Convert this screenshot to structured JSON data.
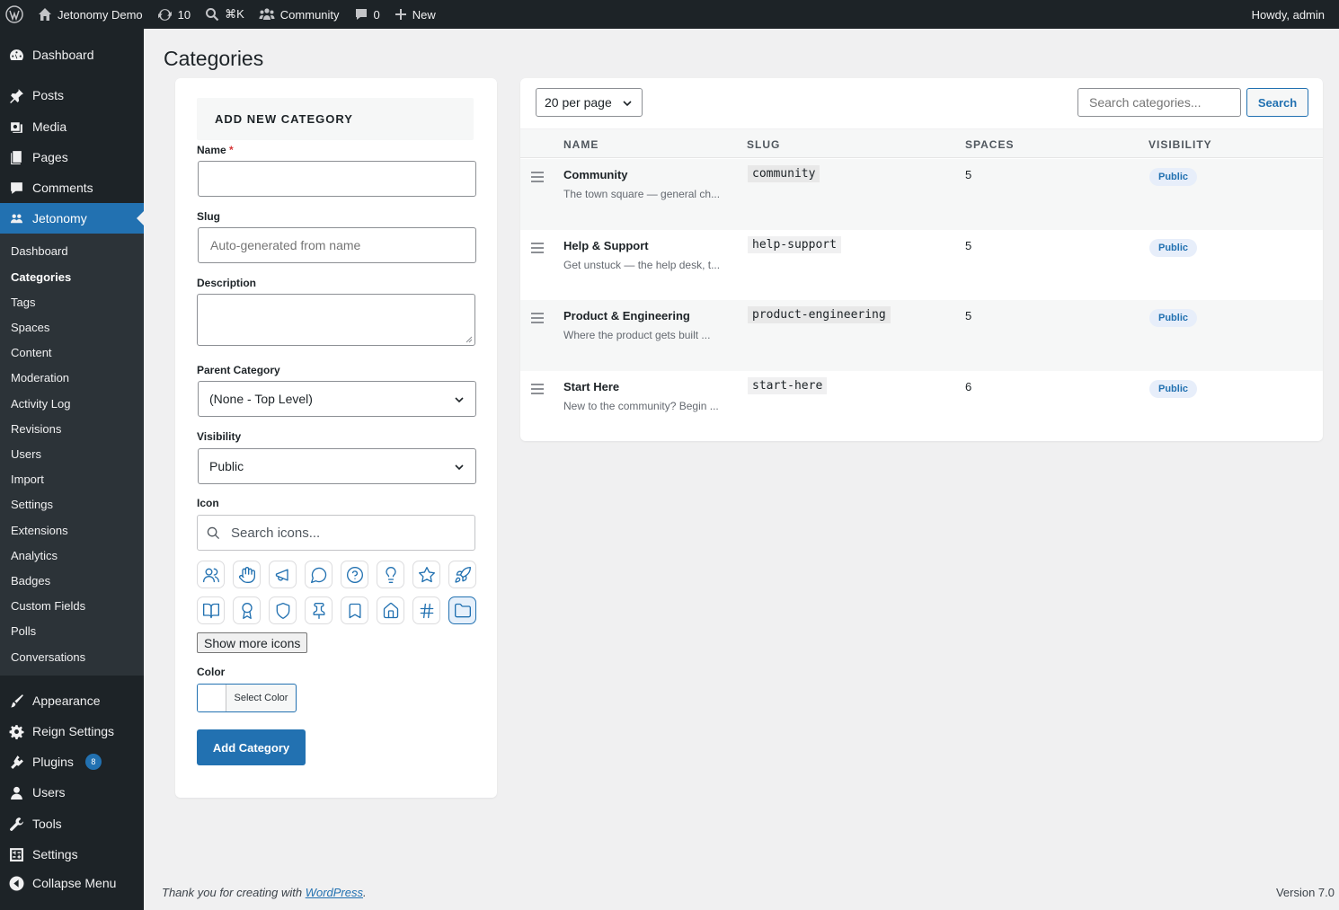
{
  "adminbar": {
    "site_name": "Jetonomy Demo",
    "updates_count": "10",
    "search_shortcut": "⌘K",
    "community_label": "Community",
    "comments_count": "0",
    "new_label": "New",
    "greeting": "Howdy, admin"
  },
  "sidebar": {
    "top_items": [
      {
        "label": "Dashboard",
        "icon": "dashboard-icon"
      },
      {
        "label": "Posts",
        "icon": "pin-icon"
      },
      {
        "label": "Media",
        "icon": "media-icon"
      },
      {
        "label": "Pages",
        "icon": "pages-icon"
      },
      {
        "label": "Comments",
        "icon": "comments-icon"
      },
      {
        "label": "Jetonomy",
        "icon": "groups-icon"
      }
    ],
    "submenu": [
      "Dashboard",
      "Categories",
      "Tags",
      "Spaces",
      "Content",
      "Moderation",
      "Activity Log",
      "Revisions",
      "Users",
      "Import",
      "Settings",
      "Extensions",
      "Analytics",
      "Badges",
      "Custom Fields",
      "Polls",
      "Conversations"
    ],
    "bottom_items": [
      {
        "label": "Appearance",
        "icon": "appearance-icon"
      },
      {
        "label": "Reign Settings",
        "icon": "gear-icon"
      },
      {
        "label": "Plugins",
        "icon": "plugins-icon",
        "badge": "8"
      },
      {
        "label": "Users",
        "icon": "users-icon"
      },
      {
        "label": "Tools",
        "icon": "tools-icon"
      },
      {
        "label": "Settings",
        "icon": "settings-icon"
      },
      {
        "label": "Collapse Menu",
        "icon": "collapse-icon"
      }
    ],
    "accent": "#2271b1"
  },
  "page": {
    "title": "Categories"
  },
  "form": {
    "header": "ADD NEW CATEGORY",
    "name_label": "Name",
    "required_mark": "*",
    "name_value": "",
    "slug_label": "Slug",
    "slug_placeholder": "Auto-generated from name",
    "description_label": "Description",
    "parent_label": "Parent Category",
    "parent_value": "(None - Top Level)",
    "visibility_label": "Visibility",
    "visibility_value": "Public",
    "icon_label": "Icon",
    "icon_search_placeholder": "Search icons...",
    "icons": [
      "users-icon",
      "hand-icon",
      "megaphone-icon",
      "chat-bubble-icon",
      "help-circle-icon",
      "lightbulb-icon",
      "star-icon",
      "rocket-icon",
      "book-icon",
      "award-icon",
      "shield-icon",
      "pin-icon",
      "bookmark-icon",
      "home-icon",
      "hash-icon",
      "folder-icon"
    ],
    "selected_icon": "folder-icon",
    "show_more_label": "Show more icons",
    "color_label": "Color",
    "color_button": "Select Color",
    "submit_label": "Add Category"
  },
  "list": {
    "per_page": "20 per page",
    "search_placeholder": "Search categories...",
    "search_button": "Search",
    "columns": [
      "NAME",
      "SLUG",
      "SPACES",
      "VISIBILITY"
    ],
    "rows": [
      {
        "name": "Community",
        "desc": "The town square — general ch...",
        "slug": "community",
        "spaces": "5",
        "visibility": "Public"
      },
      {
        "name": "Help & Support",
        "desc": "Get unstuck — the help desk, t...",
        "slug": "help-support",
        "spaces": "5",
        "visibility": "Public"
      },
      {
        "name": "Product & Engineering",
        "desc": "Where the product gets built ...",
        "slug": "product-engineering",
        "spaces": "5",
        "visibility": "Public"
      },
      {
        "name": "Start Here",
        "desc": "New to the community? Begin ...",
        "slug": "start-here",
        "spaces": "6",
        "visibility": "Public"
      }
    ]
  },
  "footer": {
    "thanks_prefix": "Thank you for creating with ",
    "link": "WordPress",
    "thanks_suffix": ".",
    "version": "Version 7.0"
  }
}
